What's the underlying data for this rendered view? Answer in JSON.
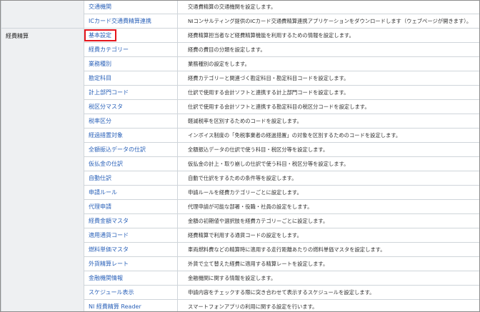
{
  "top_group": {
    "category": "",
    "rows": [
      {
        "name": "交通機関",
        "description": "交通費精算の交通機関を設定します。"
      },
      {
        "name": "ICカード交通費精算連携",
        "description": "NIコンサルティング提供のICカード交通費精算連携アプリケーションをダウンロードします（ウェブページが開きます）。"
      }
    ]
  },
  "expense_group": {
    "category": "経費精算",
    "rows": [
      {
        "name": "基本設定",
        "description": "経費精算担当者など経費精算機能を利用するための情報を設定します。"
      },
      {
        "name": "経費カテゴリー",
        "description": "経費の費目の分類を設定します。"
      },
      {
        "name": "業務種別",
        "description": "業務種別の設定をします。"
      },
      {
        "name": "勘定科目",
        "description": "経費カテゴリーと関連づく勘定科目・勘定科目コードを設定します。"
      },
      {
        "name": "計上部門コード",
        "description": "仕訳で使用する会計ソフトと連携する計上部門コードを設定します。"
      },
      {
        "name": "税区分マスタ",
        "description": "仕訳で使用する会計ソフトと連携する勘定科目の税区分コードを設定します。"
      },
      {
        "name": "税率区分",
        "description": "軽減税率を区別するためのコードを設定します。"
      },
      {
        "name": "経過措置対象",
        "description": "インボイス制度の「免税事業者の経過措置」の対象を区別するためのコードを設定します。"
      },
      {
        "name": "全額振込データの仕訳",
        "description": "全額振込データの仕訳で使う科目・税区分等を設定します。"
      },
      {
        "name": "仮払金の仕訳",
        "description": "仮払金の計上・取り崩しの仕訳で使う科目・税区分等を設定します。"
      },
      {
        "name": "自動仕訳",
        "description": "自動で仕訳をするための条件等を設定します。"
      },
      {
        "name": "申請ルール",
        "description": "申請ルールを経費カテゴリーごとに設定します。"
      },
      {
        "name": "代理申請",
        "description": "代理申請が可能な部署・役職・社員の設定をします。"
      },
      {
        "name": "経費金額マスタ",
        "description": "金額の初期値や選択肢を経費カテゴリーごとに設定します。"
      },
      {
        "name": "適用通貨コード",
        "description": "経費精算で利用する通貨コードの設定をします。"
      },
      {
        "name": "燃料単価マスタ",
        "description": "車両燃料費などの精算時に適用する走行距離あたりの燃料単価マスタを設定します。"
      },
      {
        "name": "外貨精算レート",
        "description": "外貨で立て替えた経費に適用する精算レートを設定します。"
      },
      {
        "name": "金融機関情報",
        "description": "金融機関に関する情報を設定します。"
      },
      {
        "name": "スケジュール表示",
        "description": "申請内容をチェックする際に突き合わせて表示するスケジュールを設定します。"
      },
      {
        "name": "NI 経費精算 Reader",
        "description": "スマートフォンアプリの利用に関する設定を行います。"
      }
    ]
  },
  "highlighted_item": "基本設定",
  "colors": {
    "link": "#2b62b9",
    "category_bg": "#eef0f2",
    "border": "#cfd5da",
    "highlight": "#e5141b"
  }
}
